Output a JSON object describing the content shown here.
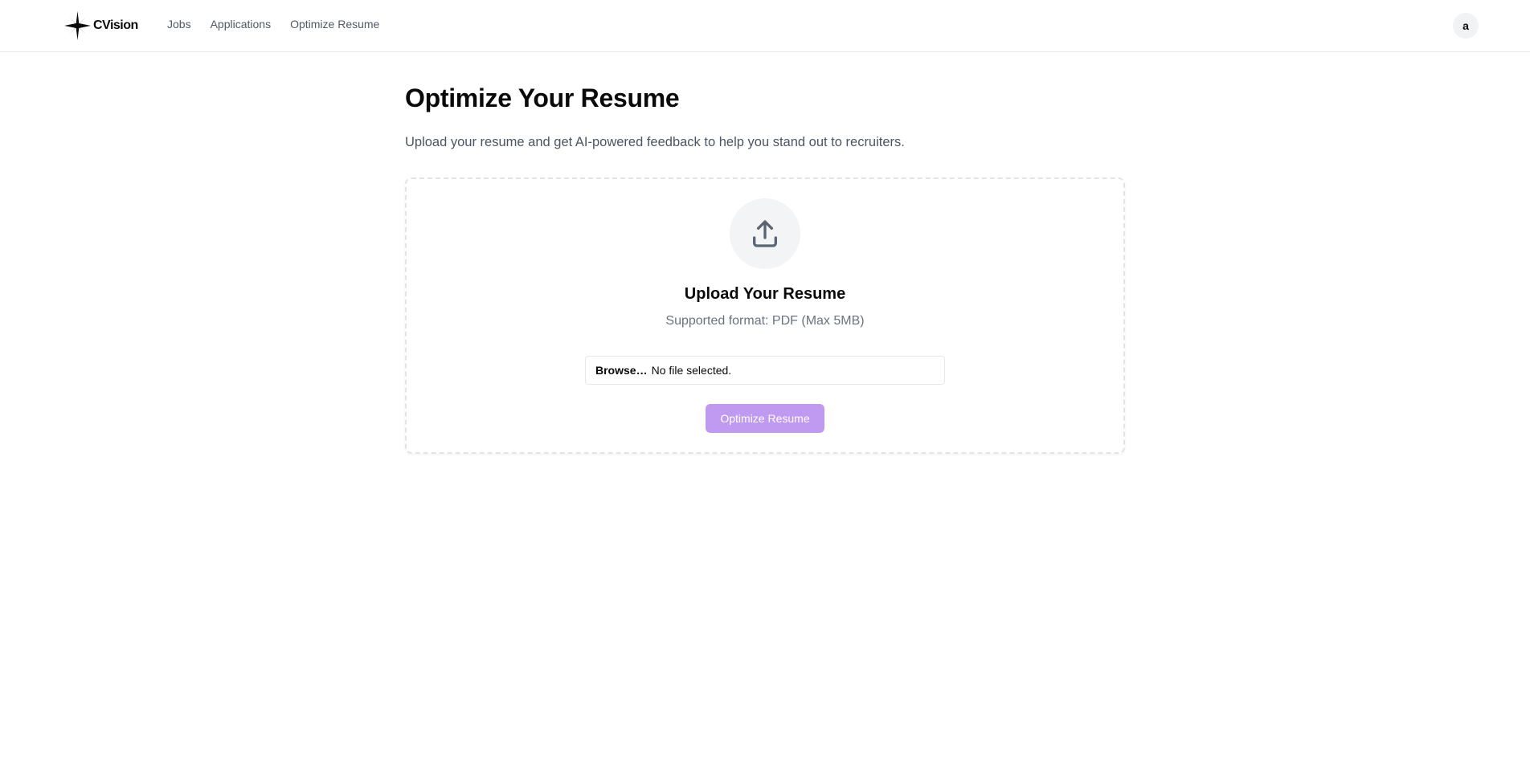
{
  "brand": {
    "name": "CVision"
  },
  "nav": {
    "links": [
      {
        "label": "Jobs"
      },
      {
        "label": "Applications"
      },
      {
        "label": "Optimize Resume"
      }
    ]
  },
  "user": {
    "avatar_initial": "a"
  },
  "page": {
    "title": "Optimize Your Resume",
    "subtitle": "Upload your resume and get AI-powered feedback to help you stand out to recruiters."
  },
  "upload": {
    "icon": "upload-icon",
    "title": "Upload Your Resume",
    "format_note": "Supported format: PDF (Max 5MB)",
    "file_input": {
      "browse_label": "Browse…",
      "status": "No file selected."
    },
    "submit_label": "Optimize Resume"
  },
  "colors": {
    "accent_disabled": "#c09af0",
    "muted_text": "#6b7280",
    "border": "#e5e7eb"
  }
}
